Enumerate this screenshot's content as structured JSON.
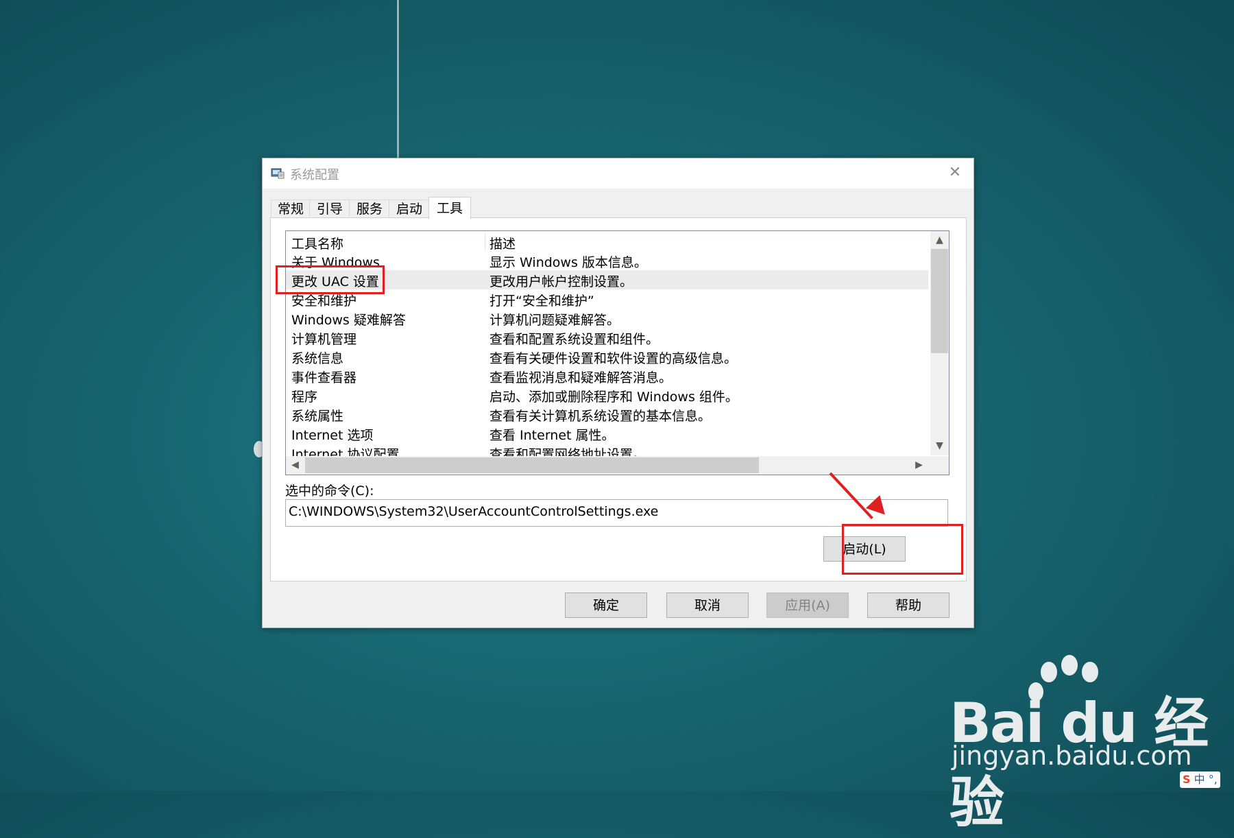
{
  "window": {
    "title": "系统配置",
    "close_glyph": "✕"
  },
  "tabs": [
    {
      "label": "常规",
      "active": false
    },
    {
      "label": "引导",
      "active": false
    },
    {
      "label": "服务",
      "active": false
    },
    {
      "label": "启动",
      "active": false
    },
    {
      "label": "工具",
      "active": true
    }
  ],
  "table": {
    "columns": [
      "工具名称",
      "描述"
    ],
    "selected_index": 1,
    "rows": [
      {
        "name": "关于 Windows",
        "desc": "显示 Windows 版本信息。"
      },
      {
        "name": "更改 UAC 设置",
        "desc": "更改用户帐户控制设置。"
      },
      {
        "name": "安全和维护",
        "desc": "打开“安全和维护”"
      },
      {
        "name": "Windows 疑难解答",
        "desc": "计算机问题疑难解答。"
      },
      {
        "name": "计算机管理",
        "desc": "查看和配置系统设置和组件。"
      },
      {
        "name": "系统信息",
        "desc": "查看有关硬件设置和软件设置的高级信息。"
      },
      {
        "name": "事件查看器",
        "desc": "查看监视消息和疑难解答消息。"
      },
      {
        "name": "程序",
        "desc": "启动、添加或删除程序和 Windows 组件。"
      },
      {
        "name": "系统属性",
        "desc": "查看有关计算机系统设置的基本信息。"
      },
      {
        "name": "Internet 选项",
        "desc": "查看 Internet 属性。"
      },
      {
        "name": "Internet 协议配置",
        "desc": "查看和配置网络地址设置。"
      }
    ]
  },
  "scroll_glyphs": {
    "up": "▲",
    "down": "▼",
    "left": "◀",
    "right": "▶"
  },
  "command": {
    "label": "选中的命令(C):",
    "value": "C:\\WINDOWS\\System32\\UserAccountControlSettings.exe"
  },
  "buttons": {
    "launch": "启动(L)",
    "ok": "确定",
    "cancel": "取消",
    "apply": "应用(A)",
    "help": "帮助"
  },
  "watermark": {
    "logo_text": "Bai du 经验",
    "url": "jingyan.baidu.com"
  },
  "ime": {
    "logo": "S",
    "mode": "中",
    "punct": "°,"
  },
  "colors": {
    "highlight": "#e02020",
    "desktop": "#17646f"
  }
}
